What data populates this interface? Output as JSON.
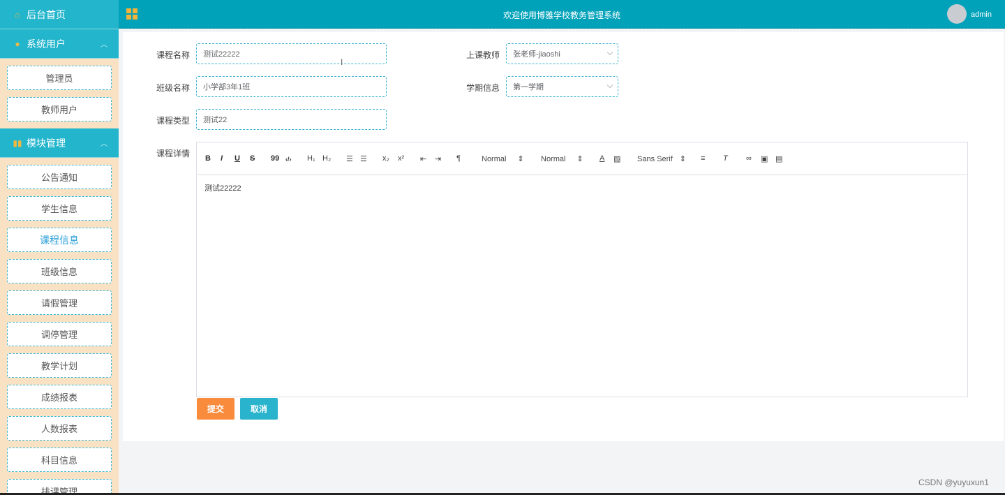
{
  "sidebar": {
    "home": "后台首页",
    "group1": {
      "title": "系统用户",
      "items": [
        "管理员",
        "教师用户"
      ]
    },
    "group2": {
      "title": "模块管理",
      "items": [
        "公告通知",
        "学生信息",
        "课程信息",
        "班级信息",
        "请假管理",
        "调停管理",
        "教学计划",
        "成绩报表",
        "人数报表",
        "科目信息",
        "排课管理"
      ],
      "active": "课程信息"
    }
  },
  "topbar": {
    "title": "欢迎使用博雅学校教务管理系统",
    "user": "admin"
  },
  "form": {
    "course_name_label": "课程名称",
    "course_name_value": "测试22222",
    "teacher_label": "上课教师",
    "teacher_value": "张老师-jiaoshi",
    "class_label": "班级名称",
    "class_value": "小学部3年1班",
    "term_label": "学期信息",
    "term_value": "第一学期",
    "type_label": "课程类型",
    "type_value": "测试22",
    "detail_label": "课程详情"
  },
  "editor": {
    "toolbar": {
      "bold": "B",
      "italic": "I",
      "underline": "U",
      "strike": "S",
      "quote": "99",
      "code": "‹/›",
      "h1": "H₁",
      "h2": "H₂",
      "sub": "x₂",
      "sup": "x²",
      "header_select": "Normal",
      "size_select": "Normal",
      "font_select": "Sans Serif"
    },
    "content": "测试22222"
  },
  "buttons": {
    "submit": "提交",
    "cancel": "取消"
  },
  "watermark": "CSDN @yuyuxun1",
  "colors": {
    "topbar": "#00a2ba",
    "sidebar_head": "#22b5cc",
    "sidebar_bg": "#f9e2c3",
    "submit": "#f98b3c",
    "cancel": "#2ab3cc"
  }
}
